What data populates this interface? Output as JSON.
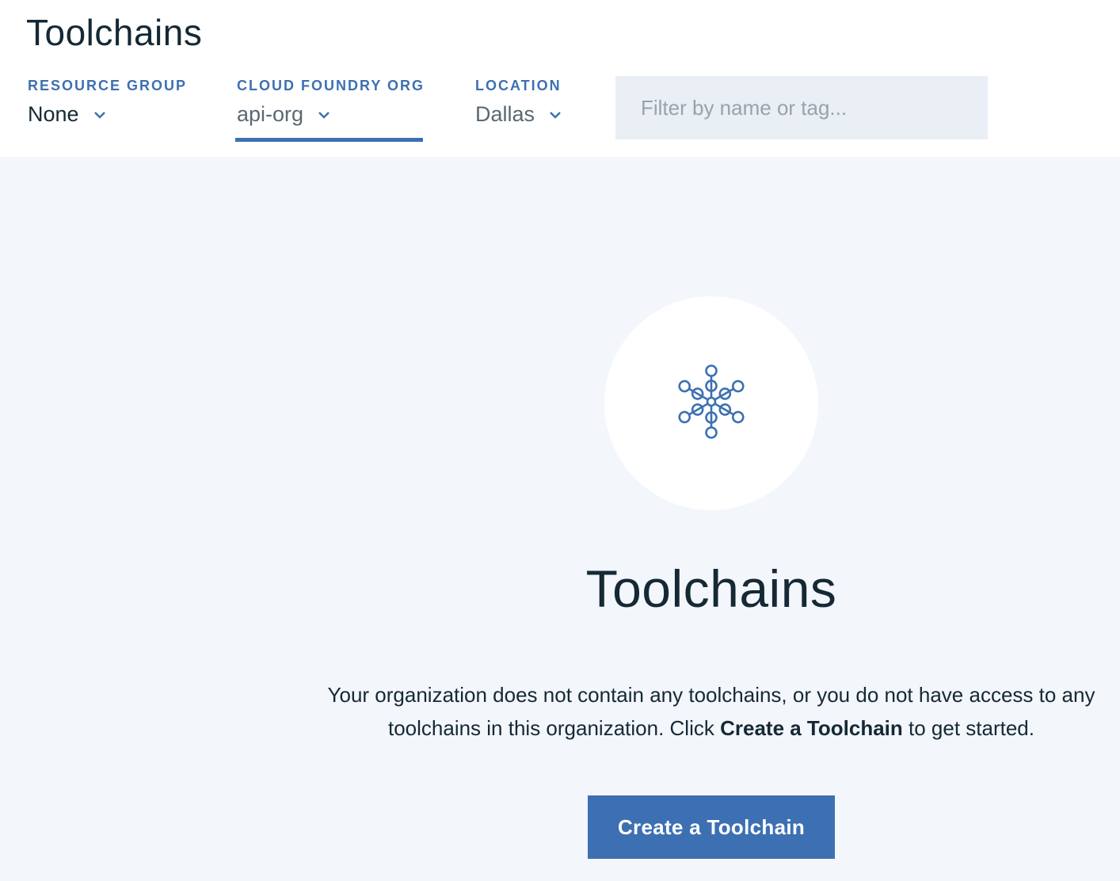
{
  "page": {
    "title": "Toolchains"
  },
  "filters": {
    "resource_group": {
      "label": "RESOURCE GROUP",
      "value": "None"
    },
    "cloud_foundry_org": {
      "label": "CLOUD FOUNDRY ORG",
      "value": "api-org"
    },
    "location": {
      "label": "LOCATION",
      "value": "Dallas"
    }
  },
  "search": {
    "placeholder": "Filter by name or tag..."
  },
  "empty_state": {
    "icon": "toolchain-icon",
    "title": "Toolchains",
    "desc_before": "Your organization does not contain any toolchains, or you do not have access to any toolchains in this organization. Click ",
    "desc_bold": "Create a Toolchain",
    "desc_after": " to get started.",
    "button_label": "Create a Toolchain"
  },
  "colors": {
    "accent": "#3d70b2",
    "background": "#f3f6fb",
    "text": "#152935"
  }
}
